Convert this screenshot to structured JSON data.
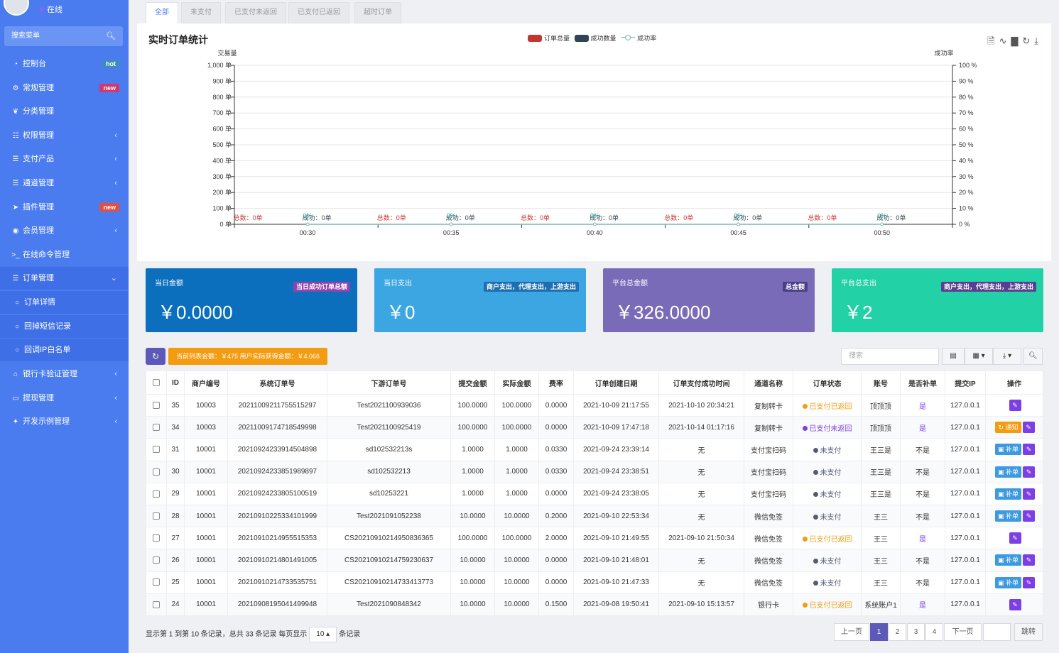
{
  "sidebar": {
    "status": "在线",
    "search_label": "搜索菜单",
    "items": [
      {
        "label": "控制台",
        "icon": "dashboard-icon",
        "badge": "hot",
        "badge_color": "#3c8dbc"
      },
      {
        "label": "常规管理",
        "icon": "cogs-icon",
        "badge": "new",
        "badge_color": "#d2386c"
      },
      {
        "label": "分类管理",
        "icon": "leaf-icon"
      },
      {
        "label": "权限管理",
        "icon": "group-icon",
        "arrow": "‹"
      },
      {
        "label": "支付产品",
        "icon": "list-icon",
        "arrow": "‹"
      },
      {
        "label": "通道管理",
        "icon": "list-icon",
        "arrow": "‹"
      },
      {
        "label": "插件管理",
        "icon": "rocket-icon",
        "badge": "new",
        "badge_color": "#e74c3c"
      },
      {
        "label": "会员管理",
        "icon": "user-circle-icon",
        "arrow": "‹"
      },
      {
        "label": "在线命令管理",
        "icon": "terminal-icon"
      },
      {
        "label": "订单管理",
        "icon": "list-icon",
        "arrow": "⌄"
      },
      {
        "label": "订单详情",
        "icon": "circle-icon"
      },
      {
        "label": "回掉短信记录",
        "icon": "circle-icon"
      },
      {
        "label": "回调IP白名单",
        "icon": "circle-icon"
      },
      {
        "label": "银行卡验证管理",
        "icon": "bank-icon",
        "arrow": "‹"
      },
      {
        "label": "提现管理",
        "icon": "cc-visa-icon",
        "arrow": "‹"
      },
      {
        "label": "开发示例管理",
        "icon": "magic-icon",
        "arrow": "‹"
      }
    ]
  },
  "tabs": [
    "全部",
    "未支付",
    "已支付未返回",
    "已支付已返回",
    "超时订单"
  ],
  "chart": {
    "title": "实时订单统计",
    "legend": [
      "订单总量",
      "成功数量",
      "成功率"
    ],
    "colors": {
      "total": "#c23531",
      "success": "#2f4554",
      "rate": "#7ab8b0"
    }
  },
  "chart_data": {
    "type": "bar",
    "title": "实时订单统计",
    "categories": [
      "00:30",
      "00:35",
      "00:40",
      "00:45",
      "00:50"
    ],
    "series": [
      {
        "name": "订单总量",
        "type": "bar",
        "values": [
          0,
          0,
          0,
          0,
          0
        ],
        "axis": "left"
      },
      {
        "name": "成功数量",
        "type": "bar",
        "values": [
          0,
          0,
          0,
          0,
          0
        ],
        "axis": "left"
      },
      {
        "name": "成功率",
        "type": "line",
        "values": [
          0,
          0,
          0,
          0,
          0
        ],
        "axis": "right"
      }
    ],
    "ylabel": "交易量",
    "y2label": "成功率",
    "ylim": [
      0,
      1000
    ],
    "y2lim": [
      0,
      100
    ],
    "yticks": [
      "0 单",
      "100 单",
      "200 单",
      "300 单",
      "400 单",
      "500 单",
      "600 单",
      "700 单",
      "800 单",
      "900 单",
      "1,000 单"
    ],
    "y2ticks": [
      "0 %",
      "10 %",
      "20 %",
      "30 %",
      "40 %",
      "50 %",
      "60 %",
      "70 %",
      "80 %",
      "90 %",
      "100 %"
    ],
    "annotations": {
      "total": "总数：0单",
      "success": "成功：0单",
      "rate": "0%"
    },
    "grid": true,
    "legend_position": "top-center"
  },
  "cards": [
    {
      "label": "当日金额",
      "tag": "当日成功订单总额",
      "value": "￥0.0000",
      "bg": "#0b6fbd",
      "tag_bg": "#8e44ad"
    },
    {
      "label": "当日支出",
      "tag": "商户支出，代理支出，上游支出",
      "value": "￥0",
      "bg": "#3ca6e2",
      "tag_bg": "#1f6fb0"
    },
    {
      "label": "平台总金额",
      "tag": "总金额",
      "value": "￥326.0000",
      "bg": "#7a6bb8",
      "tag_bg": "#4b3f88"
    },
    {
      "label": "平台总支出",
      "tag": "商户支出，代理支出，上游支出",
      "value": "￥2",
      "bg": "#22d1a6",
      "tag_bg": "#5b3e92"
    }
  ],
  "toolbar": {
    "sum_text": "当前列表金额：￥475  用户实际获得金额：￥4.066",
    "search_placeholder": "搜索"
  },
  "table": {
    "headers": [
      "ID",
      "商户编号",
      "系统订单号",
      "下游订单号",
      "提交金额",
      "实际金额",
      "费率",
      "订单创建日期",
      "订单支付成功时间",
      "通道名称",
      "订单状态",
      "账号",
      "是否补单",
      "提交IP",
      "操作"
    ],
    "rows": [
      {
        "id": "35",
        "merchant": "10003",
        "sys_no": "20211009211755515297",
        "down_no": "Test2021100939036",
        "submit": "100.0000",
        "actual": "100.0000",
        "rate": "0.0000",
        "created": "2021-10-09 21:17:55",
        "paid": "2021-10-10 20:34:21",
        "channel": "复制转卡",
        "status": "已支付已返回",
        "status_color": "#f39c12",
        "account": "顶顶顶",
        "supp": "是",
        "ip": "127.0.0.1",
        "action": ""
      },
      {
        "id": "34",
        "merchant": "10003",
        "sys_no": "20211009174718549998",
        "down_no": "Test2021100925419",
        "submit": "100.0000",
        "actual": "100.0000",
        "rate": "0.0000",
        "created": "2021-10-09 17:47:18",
        "paid": "2021-10-14 01:17:16",
        "channel": "复制转卡",
        "status": "已支付未返回",
        "status_color": "#7b3fe4",
        "account": "顶顶顶",
        "supp": "是",
        "ip": "127.0.0.1",
        "action": "通知"
      },
      {
        "id": "31",
        "merchant": "10001",
        "sys_no": "20210924233914504898",
        "down_no": "sd102532213s",
        "submit": "1.0000",
        "actual": "1.0000",
        "rate": "0.0330",
        "created": "2021-09-24 23:39:14",
        "paid": "无",
        "channel": "支付宝扫码",
        "status": "未支付",
        "status_color": "#555a7a",
        "account": "王三是",
        "supp": "不是",
        "ip": "127.0.0.1",
        "action": "补单"
      },
      {
        "id": "30",
        "merchant": "10001",
        "sys_no": "20210924233851989897",
        "down_no": "sd102532213",
        "submit": "1.0000",
        "actual": "1.0000",
        "rate": "0.0330",
        "created": "2021-09-24 23:38:51",
        "paid": "无",
        "channel": "支付宝扫码",
        "status": "未支付",
        "status_color": "#555a7a",
        "account": "王三是",
        "supp": "不是",
        "ip": "127.0.0.1",
        "action": "补单"
      },
      {
        "id": "29",
        "merchant": "10001",
        "sys_no": "20210924233805100519",
        "down_no": "sd10253221",
        "submit": "1.0000",
        "actual": "1.0000",
        "rate": "0.0000",
        "created": "2021-09-24 23:38:05",
        "paid": "无",
        "channel": "支付宝扫码",
        "status": "未支付",
        "status_color": "#555a7a",
        "account": "王三是",
        "supp": "不是",
        "ip": "127.0.0.1",
        "action": "补单"
      },
      {
        "id": "28",
        "merchant": "10001",
        "sys_no": "20210910225334101999",
        "down_no": "Test2021091052238",
        "submit": "10.0000",
        "actual": "10.0000",
        "rate": "0.2000",
        "created": "2021-09-10 22:53:34",
        "paid": "无",
        "channel": "微信免签",
        "status": "未支付",
        "status_color": "#555a7a",
        "account": "王三",
        "supp": "不是",
        "ip": "127.0.0.1",
        "action": "补单"
      },
      {
        "id": "27",
        "merchant": "10001",
        "sys_no": "20210910214955515353",
        "down_no": "CS20210910214950836365",
        "submit": "100.0000",
        "actual": "100.0000",
        "rate": "2.0000",
        "created": "2021-09-10 21:49:55",
        "paid": "2021-09-10 21:50:34",
        "channel": "微信免签",
        "status": "已支付已返回",
        "status_color": "#f39c12",
        "account": "王三",
        "supp": "是",
        "ip": "127.0.0.1",
        "action": ""
      },
      {
        "id": "26",
        "merchant": "10001",
        "sys_no": "20210910214801491005",
        "down_no": "CS20210910214759230637",
        "submit": "10.0000",
        "actual": "10.0000",
        "rate": "0.0000",
        "created": "2021-09-10 21:48:01",
        "paid": "无",
        "channel": "微信免签",
        "status": "未支付",
        "status_color": "#555a7a",
        "account": "王三",
        "supp": "不是",
        "ip": "127.0.0.1",
        "action": "补单"
      },
      {
        "id": "25",
        "merchant": "10001",
        "sys_no": "20210910214733535751",
        "down_no": "CS20210910214733413773",
        "submit": "10.0000",
        "actual": "10.0000",
        "rate": "0.0000",
        "created": "2021-09-10 21:47:33",
        "paid": "无",
        "channel": "微信免签",
        "status": "未支付",
        "status_color": "#555a7a",
        "account": "王三",
        "supp": "不是",
        "ip": "127.0.0.1",
        "action": "补单"
      },
      {
        "id": "24",
        "merchant": "10001",
        "sys_no": "20210908195041499948",
        "down_no": "Test2021090848342",
        "submit": "10.0000",
        "actual": "10.0000",
        "rate": "0.1500",
        "created": "2021-09-08 19:50:41",
        "paid": "2021-09-10 15:13:57",
        "channel": "银行卡",
        "status": "已支付已返回",
        "status_color": "#f39c12",
        "account": "系统账户1",
        "supp": "是",
        "ip": "127.0.0.1",
        "action": ""
      }
    ]
  },
  "footer": {
    "info_prefix": "显示第 1 到第 10 条记录，总共 33 条记录 每页显示",
    "page_size": "10",
    "info_suffix": "条记录",
    "prev": "上一页",
    "pages": [
      "1",
      "2",
      "3",
      "4"
    ],
    "next": "下一页",
    "jump": "跳转"
  }
}
